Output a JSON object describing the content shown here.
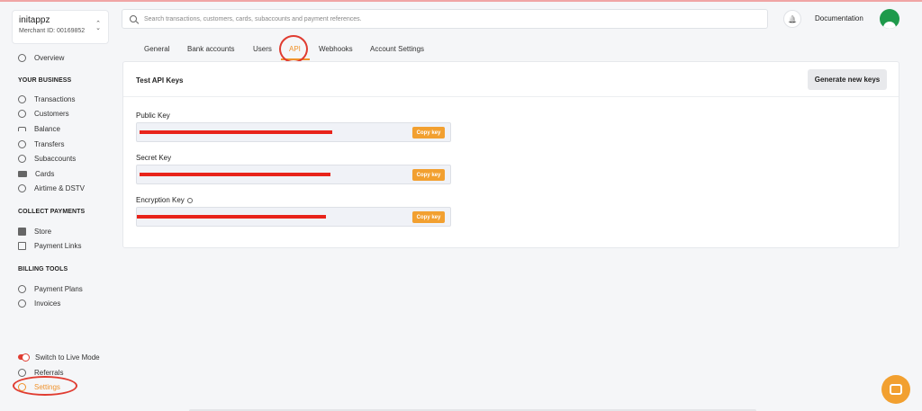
{
  "merchant": {
    "name": "initappz",
    "merchant_id": "Merchant ID: 00169852",
    "caret": "⌃⌄"
  },
  "sidebar": {
    "overview": "Overview",
    "your_business_title": "YOUR BUSINESS",
    "business_items": [
      "Transactions",
      "Customers",
      "Balance",
      "Transfers",
      "Subaccounts",
      "Cards",
      "Airtime & DSTV"
    ],
    "collect_title": "COLLECT PAYMENTS",
    "collect_items": [
      "Store",
      "Payment Links"
    ],
    "billing_title": "BILLING TOOLS",
    "billing_items": [
      "Payment Plans",
      "Invoices"
    ],
    "live_mode": "Switch to Live Mode",
    "referrals": "Referrals",
    "settings": "Settings"
  },
  "search": {
    "placeholder": "Search transactions, customers, cards, subaccounts and payment references."
  },
  "header": {
    "bell_icon": "🔔",
    "documentation": "Documentation"
  },
  "tabs": [
    "General",
    "Bank accounts",
    "Users",
    "API",
    "Webhooks",
    "Account Settings"
  ],
  "panel": {
    "title": "Test API Keys",
    "generate_button": "Generate new keys",
    "keys": [
      {
        "label": "Public Key",
        "copy": "Copy key"
      },
      {
        "label": "Secret Key",
        "copy": "Copy key"
      },
      {
        "label": "Encryption Key",
        "copy": "Copy key"
      }
    ]
  },
  "colors": {
    "accent": "#f0922b",
    "annotation": "#e03c31",
    "redaction": "#e8231a"
  }
}
